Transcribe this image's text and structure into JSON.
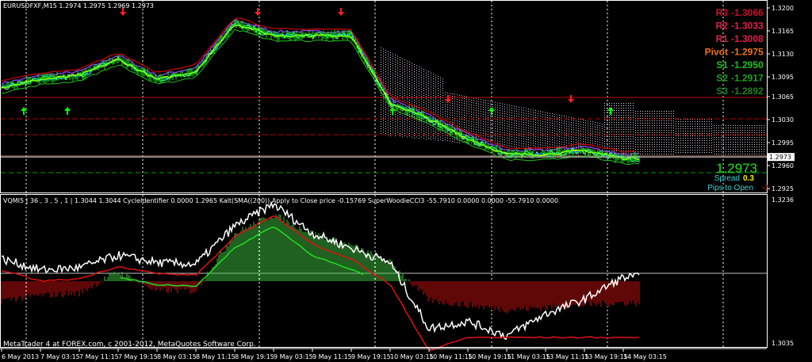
{
  "window": {
    "symbol_header": "EURUSDFXF,M15  1.2974 1.2975 1.2969 1.2973",
    "copyright": "MetaTrader 4 at FOREX.com, c 2001-2012, MetaQuotes Software Corp."
  },
  "pivots": [
    {
      "label": "R3",
      "value": "-1.3066",
      "color": "#c8102e"
    },
    {
      "label": "R2",
      "value": "-1.3033",
      "color": "#e0204a"
    },
    {
      "label": "R1",
      "value": "-1.3008",
      "color": "#e0204a"
    },
    {
      "label": "Pivot",
      "value": "-1.2975",
      "color": "#f07020"
    },
    {
      "label": "S1",
      "value": "-1.2950",
      "color": "#20c020"
    },
    {
      "label": "S2",
      "value": "-1.2917",
      "color": "#20a020"
    },
    {
      "label": "S3",
      "value": "-1.2892",
      "color": "#208020"
    }
  ],
  "info_panel": {
    "price": "1.2973",
    "spread_label": "Spread",
    "spread_value": "0.3",
    "pips_label": "Pips to Open",
    "pips_value": "-1"
  },
  "indicator_header": "VQMI5 | 36 , 3 , 5 , 1 | 1.3044 1.3044  CycleIdentifier 0.0000 1.2965  Kalt(SMA((200)) Apply to Close price -0.15769  SuperWoodieCCI3 -55.7910 0.0000 0.0000 -55.7910 0.0000",
  "colors": {
    "bull": "#00ff00",
    "bear": "#ff2020",
    "grid": "#ffffff",
    "background": "#000000"
  },
  "chart_data": [
    {
      "type": "line",
      "title": "EURUSDFXF,M15",
      "x": [
        "6 May 2013",
        "7 May 03:15",
        "7 May 11:15",
        "7 May 19:15",
        "8 May 03:15",
        "8 May 11:15",
        "8 May 19:15",
        "9 May 03:15",
        "9 May 11:15",
        "9 May 19:15",
        "10 May 03:15",
        "10 May 11:15",
        "10 May 19:15",
        "11 May 03:15",
        "13 May 11:15",
        "13 May 19:15",
        "14 May 03:15"
      ],
      "series": [
        {
          "values": [
            1.3079,
            1.3091,
            1.3097,
            1.3122,
            1.3091,
            1.3103,
            1.3176,
            1.3158,
            1.3158,
            1.3158,
            1.3055,
            1.3031,
            1.3001,
            1.2977,
            1.2977,
            1.2983,
            1.2971
          ]
        }
      ],
      "y_ticks": [
        "1.3200",
        "1.3165",
        "1.3130",
        "1.3095",
        "1.3065",
        "1.3030",
        "1.2995",
        "1.2960",
        "1.2925"
      ],
      "current_price": "1.2973",
      "ylim": [
        1.2912,
        1.3212
      ]
    },
    {
      "type": "bar",
      "title": "VQMI5",
      "x": [
        "6 May 2013",
        "7 May 03:15",
        "7 May 11:15",
        "7 May 19:15",
        "8 May 03:15",
        "8 May 11:15",
        "8 May 19:15",
        "9 May 03:15",
        "9 May 11:15",
        "9 May 19:15",
        "10 May 03:15",
        "10 May 11:15",
        "10 May 19:15",
        "11 May 03:15",
        "13 May 11:15",
        "13 May 19:15",
        "14 May 03:15"
      ],
      "histogram": [
        -80,
        -60,
        -50,
        40,
        -40,
        -40,
        200,
        280,
        200,
        150,
        80,
        -80,
        -100,
        -120,
        -110,
        -100,
        -90
      ],
      "line": [
        1.3155,
        1.314,
        1.3143,
        1.316,
        1.315,
        1.3148,
        1.32,
        1.323,
        1.319,
        1.317,
        1.315,
        1.306,
        1.307,
        1.305,
        1.308,
        1.31,
        1.313
      ],
      "y_ticks": [
        "1.3236",
        "1.3035"
      ]
    }
  ]
}
